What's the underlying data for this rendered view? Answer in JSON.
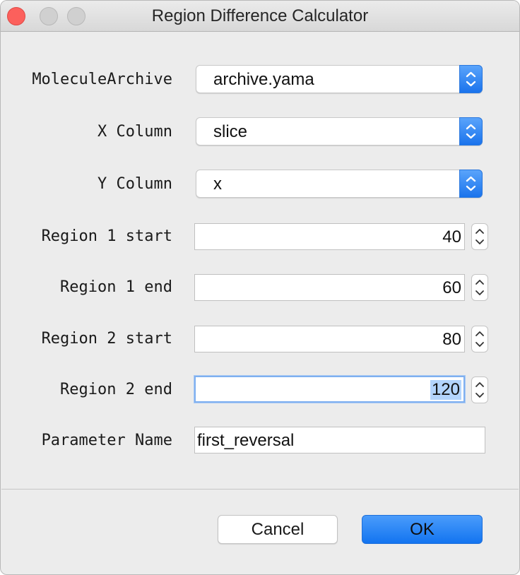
{
  "window": {
    "title": "Region Difference Calculator"
  },
  "form": {
    "archive": {
      "label": "MoleculeArchive",
      "value": "archive.yama"
    },
    "x_column": {
      "label": "X Column",
      "value": "slice"
    },
    "y_column": {
      "label": "Y Column",
      "value": "x"
    },
    "region1_start": {
      "label": "Region 1 start",
      "value": "40"
    },
    "region1_end": {
      "label": "Region 1 end",
      "value": "60"
    },
    "region2_start": {
      "label": "Region 2 start",
      "value": "80"
    },
    "region2_end": {
      "label": "Region 2 end",
      "value": "120"
    },
    "parameter_name": {
      "label": "Parameter Name",
      "value": "first_reversal"
    }
  },
  "buttons": {
    "cancel": "Cancel",
    "ok": "OK"
  },
  "colors": {
    "accent": "#1a73ec",
    "close": "#fc605c",
    "selection": "#b3d4fc"
  }
}
